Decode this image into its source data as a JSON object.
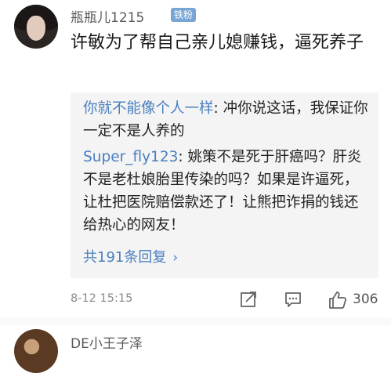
{
  "comment": {
    "username": "瓶瓶儿1215",
    "badge": "铁粉",
    "text": "许敏为了帮自己亲儿媳赚钱，逼死养子",
    "time": "8-12 15:15",
    "likes": "306"
  },
  "replies": [
    {
      "user": "你就不能像个人一样",
      "text": ": 冲你说这话，我保证你一定不是人养的"
    },
    {
      "user": "Super_fly123",
      "text": ": 姚策不是死于肝癌吗？肝炎不是老杜娘胎里传染的吗？如果是许逼死，让杜把医院赔偿款还了！让熊把诈捐的钱还给热心的网友！"
    }
  ],
  "more_replies": "共191条回复",
  "next_comment": {
    "username": "DE小王子泽"
  },
  "icons": {
    "edit": "share-edit-icon",
    "reply": "comment-icon",
    "like": "thumbs-up-icon",
    "chevron": "chevron-right-icon"
  }
}
